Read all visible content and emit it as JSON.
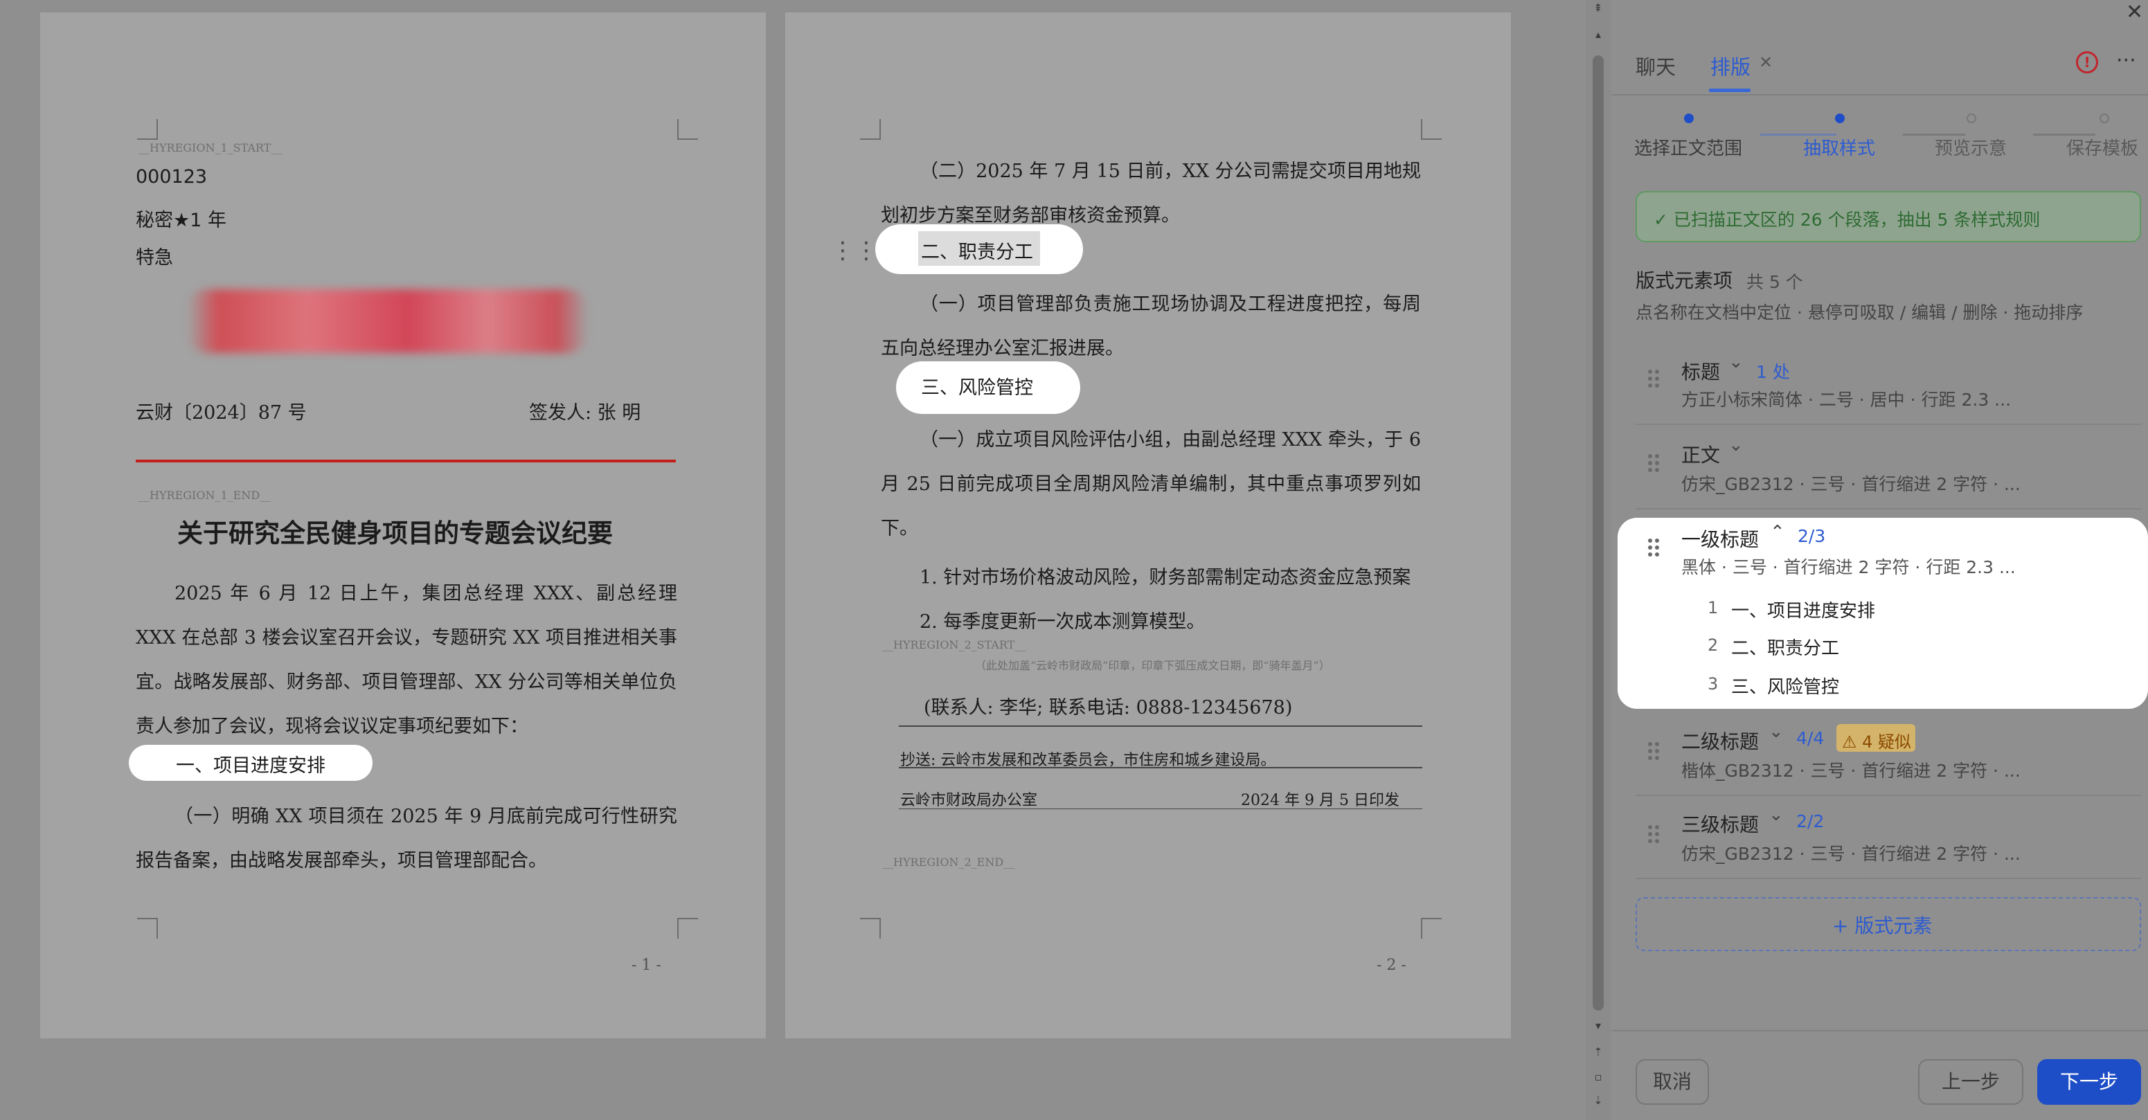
{
  "page1": {
    "region_start": "__HYREGION_1_START__",
    "doc_number": "000123",
    "secrecy": "秘密★1 年",
    "urgency": "特急",
    "file_no": "云财〔2024〕87 号",
    "signer": "签发人: 张  明",
    "region_end": "__HYREGION_1_END__",
    "title": "关于研究全民健身项目的专题会议纪要",
    "para1": "2025 年 6 月 12 日上午，集团总经理 XXX、副总经理 XXX 在总部 3 楼会议室召开会议，专题研究 XX 项目推进相关事宜。战略发展部、财务部、项目管理部、XX 分公司等相关单位负责人参加了会议，现将会议议定事项纪要如下：",
    "heading1": "一、项目进度安排",
    "para2": "（一）明确 XX 项目须在 2025 年 9 月底前完成可行性研究报告备案，由战略发展部牵头，项目管理部配合。",
    "page_num": "- 1 -"
  },
  "page2": {
    "para1": "（二）2025 年 7 月 15 日前，XX 分公司需提交项目用地规划初步方案至财务部审核资金预算。",
    "heading2": "二、职责分工",
    "para2": "（一）项目管理部负责施工现场协调及工程进度把控，每周五向总经理办公室汇报进展。",
    "heading3": "三、风险管控",
    "para3": "（一）成立项目风险评估小组，由副总经理 XXX 牵头，于 6 月 25 日前完成项目全周期风险清单编制，其中重点事项罗列如下。",
    "item1": "1. 针对市场价格波动风险，财务部需制定动态资金应急预案",
    "item2": "2. 每季度更新一次成本测算模型。",
    "region2_start": "__HYREGION_2_START__",
    "seal_note": "（此处加盖“云岭市财政局”印章，印章下弧压成文日期，即“骑年盖月”）",
    "contact": "(联系人: 李华; 联系电话: 0888-12345678)",
    "cc": "抄送: 云岭市发展和改革委员会，市住房和城乡建设局。",
    "issuer": "云岭市财政局办公室",
    "issue_date": "2024 年 9 月 5 日印发",
    "region2_end": "__HYREGION_2_END__",
    "page_num": "- 2 -"
  },
  "panel": {
    "close": "✕",
    "tabs": [
      {
        "label": "聊天"
      },
      {
        "label": "排版",
        "close": "✕"
      }
    ],
    "alert_icon": "alert-circle-icon",
    "more": "···",
    "steps": [
      {
        "label": "选择正文范围",
        "state": "done"
      },
      {
        "label": "抽取样式",
        "state": "active"
      },
      {
        "label": "预览示意",
        "state": "todo"
      },
      {
        "label": "保存模板",
        "state": "todo"
      }
    ],
    "success_msg": "✓ 已扫描正文区的 26 个段落，抽出 5 条样式规则",
    "section_title": "版式元素项",
    "section_count": "共 5 个",
    "section_hint": "点名称在文档中定位 · 悬停可吸取 / 编辑 / 删除 · 拖动排序",
    "elements": [
      {
        "name": "标题",
        "chevron": "⌄",
        "count": "1 处",
        "desc": "方正小标宋简体 · 二号 · 居中 · 行距 2.3 ..."
      },
      {
        "name": "正文",
        "chevron": "⌄",
        "count": "",
        "desc": "仿宋_GB2312 · 三号 · 首行缩进 2 字符 · ..."
      },
      {
        "name": "一级标题",
        "chevron": "⌃",
        "count": "2/3",
        "desc": "黑体 · 三号 · 首行缩进 2 字符 · 行距 2.3 ...",
        "children": [
          {
            "idx": "1",
            "text": "一、项目进度安排"
          },
          {
            "idx": "2",
            "text": "二、职责分工"
          },
          {
            "idx": "3",
            "text": "三、风险管控"
          }
        ]
      },
      {
        "name": "二级标题",
        "chevron": "⌄",
        "count": "4/4",
        "warn": "⚠ 4 疑似",
        "desc": "楷体_GB2312 · 三号 · 首行缩进 2 字符 · ..."
      },
      {
        "name": "三级标题",
        "chevron": "⌄",
        "count": "2/2",
        "desc": "仿宋_GB2312 · 三号 · 首行缩进 2 字符 · ..."
      }
    ],
    "add_label": "+  版式元素",
    "cancel": "取消",
    "prev": "上一步",
    "next": "下一步"
  },
  "colors": {
    "accent": "#1e4ec7",
    "red_line": "#c3201c",
    "success": "#5e9a62",
    "warning": "#d4b46a"
  }
}
